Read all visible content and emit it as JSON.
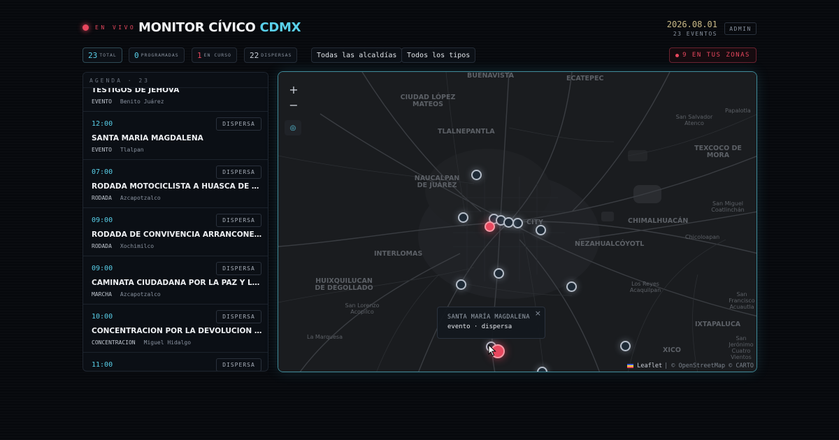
{
  "header": {
    "live_label": "EN VIVO",
    "title_main": "MONITOR CÍVICO",
    "title_accent": "CDMX",
    "date": "2026.08.01",
    "events_count": "23 EVENTOS",
    "admin_label": "ADMIN"
  },
  "filters": {
    "total": {
      "count": "23",
      "label": "TOTAL"
    },
    "scheduled": {
      "count": "0",
      "label": "PROGRAMADAS"
    },
    "in_progress": {
      "count": "1",
      "label": "EN CURSO"
    },
    "dispersed": {
      "count": "22",
      "label": "DISPERSAS"
    },
    "borough_select": "Todas las alcaldías",
    "type_select": "Todos los tipos",
    "zones_alert": "9 EN TUS ZONAS"
  },
  "agenda": {
    "header": "AGENDA · 23",
    "items": [
      {
        "time": "",
        "status": "",
        "title": "TESTIGOS DE JEHOVÁ",
        "type": "EVENTO",
        "place": "Benito Juárez"
      },
      {
        "time": "12:00",
        "status": "DISPERSA",
        "title": "SANTA MARÍA MAGDALENA",
        "type": "EVENTO",
        "place": "Tlalpan"
      },
      {
        "time": "07:00",
        "status": "DISPERSA",
        "title": "RODADA MOTOCICLISTA A HUASCA DE OCAMPO",
        "type": "RODADA",
        "place": "Azcapotzalco"
      },
      {
        "time": "09:00",
        "status": "DISPERSA",
        "title": "RODADA DE CONVIVENCIA ARRANCONES TLÁHUAC",
        "type": "RODADA",
        "place": "Xochimilco"
      },
      {
        "time": "09:00",
        "status": "DISPERSA",
        "title": "CAMINATA CIUDADANA POR LA PAZ Y LA UNIDAD",
        "type": "MARCHA",
        "place": "Azcapotzalco"
      },
      {
        "time": "10:00",
        "status": "DISPERSA",
        "title": "CONCENTRACIÓN POR LA DEVOLUCIÓN DE ANIMALES",
        "type": "CONCENTRACION",
        "place": "Miguel Hidalgo"
      },
      {
        "time": "11:00",
        "status": "DISPERSA",
        "title": "",
        "type": "",
        "place": ""
      }
    ]
  },
  "map": {
    "zoom_in": "+",
    "zoom_out": "−",
    "locate_icon": "◎",
    "labels": [
      "BUENAVISTA",
      "ECATEPEC",
      "CIUDAD LÓPEZ MATEOS",
      "TLALNEPANTLA",
      "NAUCALPAN DE JUÁREZ",
      "CITY",
      "CHIMALHUACÁN",
      "NEZAHUALCÓYOTL",
      "INTERLOMAS",
      "HUIXQUILUCAN DE DEGOLLADO",
      "TEXCOCO DE MORA",
      "IXTAPALUCA",
      "XICO"
    ],
    "small_labels": [
      "San Salvador Atenco",
      "Papalotla",
      "San Miguel Coatlinchán",
      "Chicoloapan",
      "Los Reyes Acaquilpan",
      "San Lorenzo Acopilco",
      "La Marquesa",
      "San Francisco Acuautla",
      "San Jerónimo Cuatro Vientos"
    ],
    "popup": {
      "title": "SANTA MARÍA MAGDALENA",
      "subtitle": "evento · dispersa",
      "close": "×"
    },
    "attribution_leaflet": "Leaflet",
    "attribution_rest": "| © OpenStreetMap © CARTO",
    "colors": {
      "accent": "#59d0ea",
      "alert": "#e8475e",
      "map_bg": "#1a1c1f"
    }
  }
}
